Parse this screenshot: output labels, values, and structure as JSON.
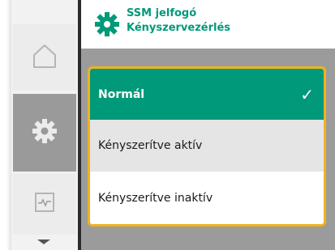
{
  "header": {
    "title_line1": "SSM jelfogó",
    "title_line2": "Kényszervezérlés",
    "icon": "gear-icon"
  },
  "nav": {
    "items": [
      {
        "icon": "home-icon",
        "active": false
      },
      {
        "icon": "settings-icon",
        "active": true
      },
      {
        "icon": "diagnostics-icon",
        "active": false
      }
    ],
    "scroll_icon": "chevron-down-icon"
  },
  "menu": {
    "items": [
      {
        "label": "Normál",
        "selected": true,
        "check": "✓"
      },
      {
        "label": "Kényszerítve aktív",
        "selected": false
      },
      {
        "label": "Kényszerítve inaktív",
        "selected": false
      }
    ]
  },
  "colors": {
    "accent": "#00997a",
    "focus_frame": "#f2b21e",
    "panel_bg": "#9b9b9b"
  }
}
